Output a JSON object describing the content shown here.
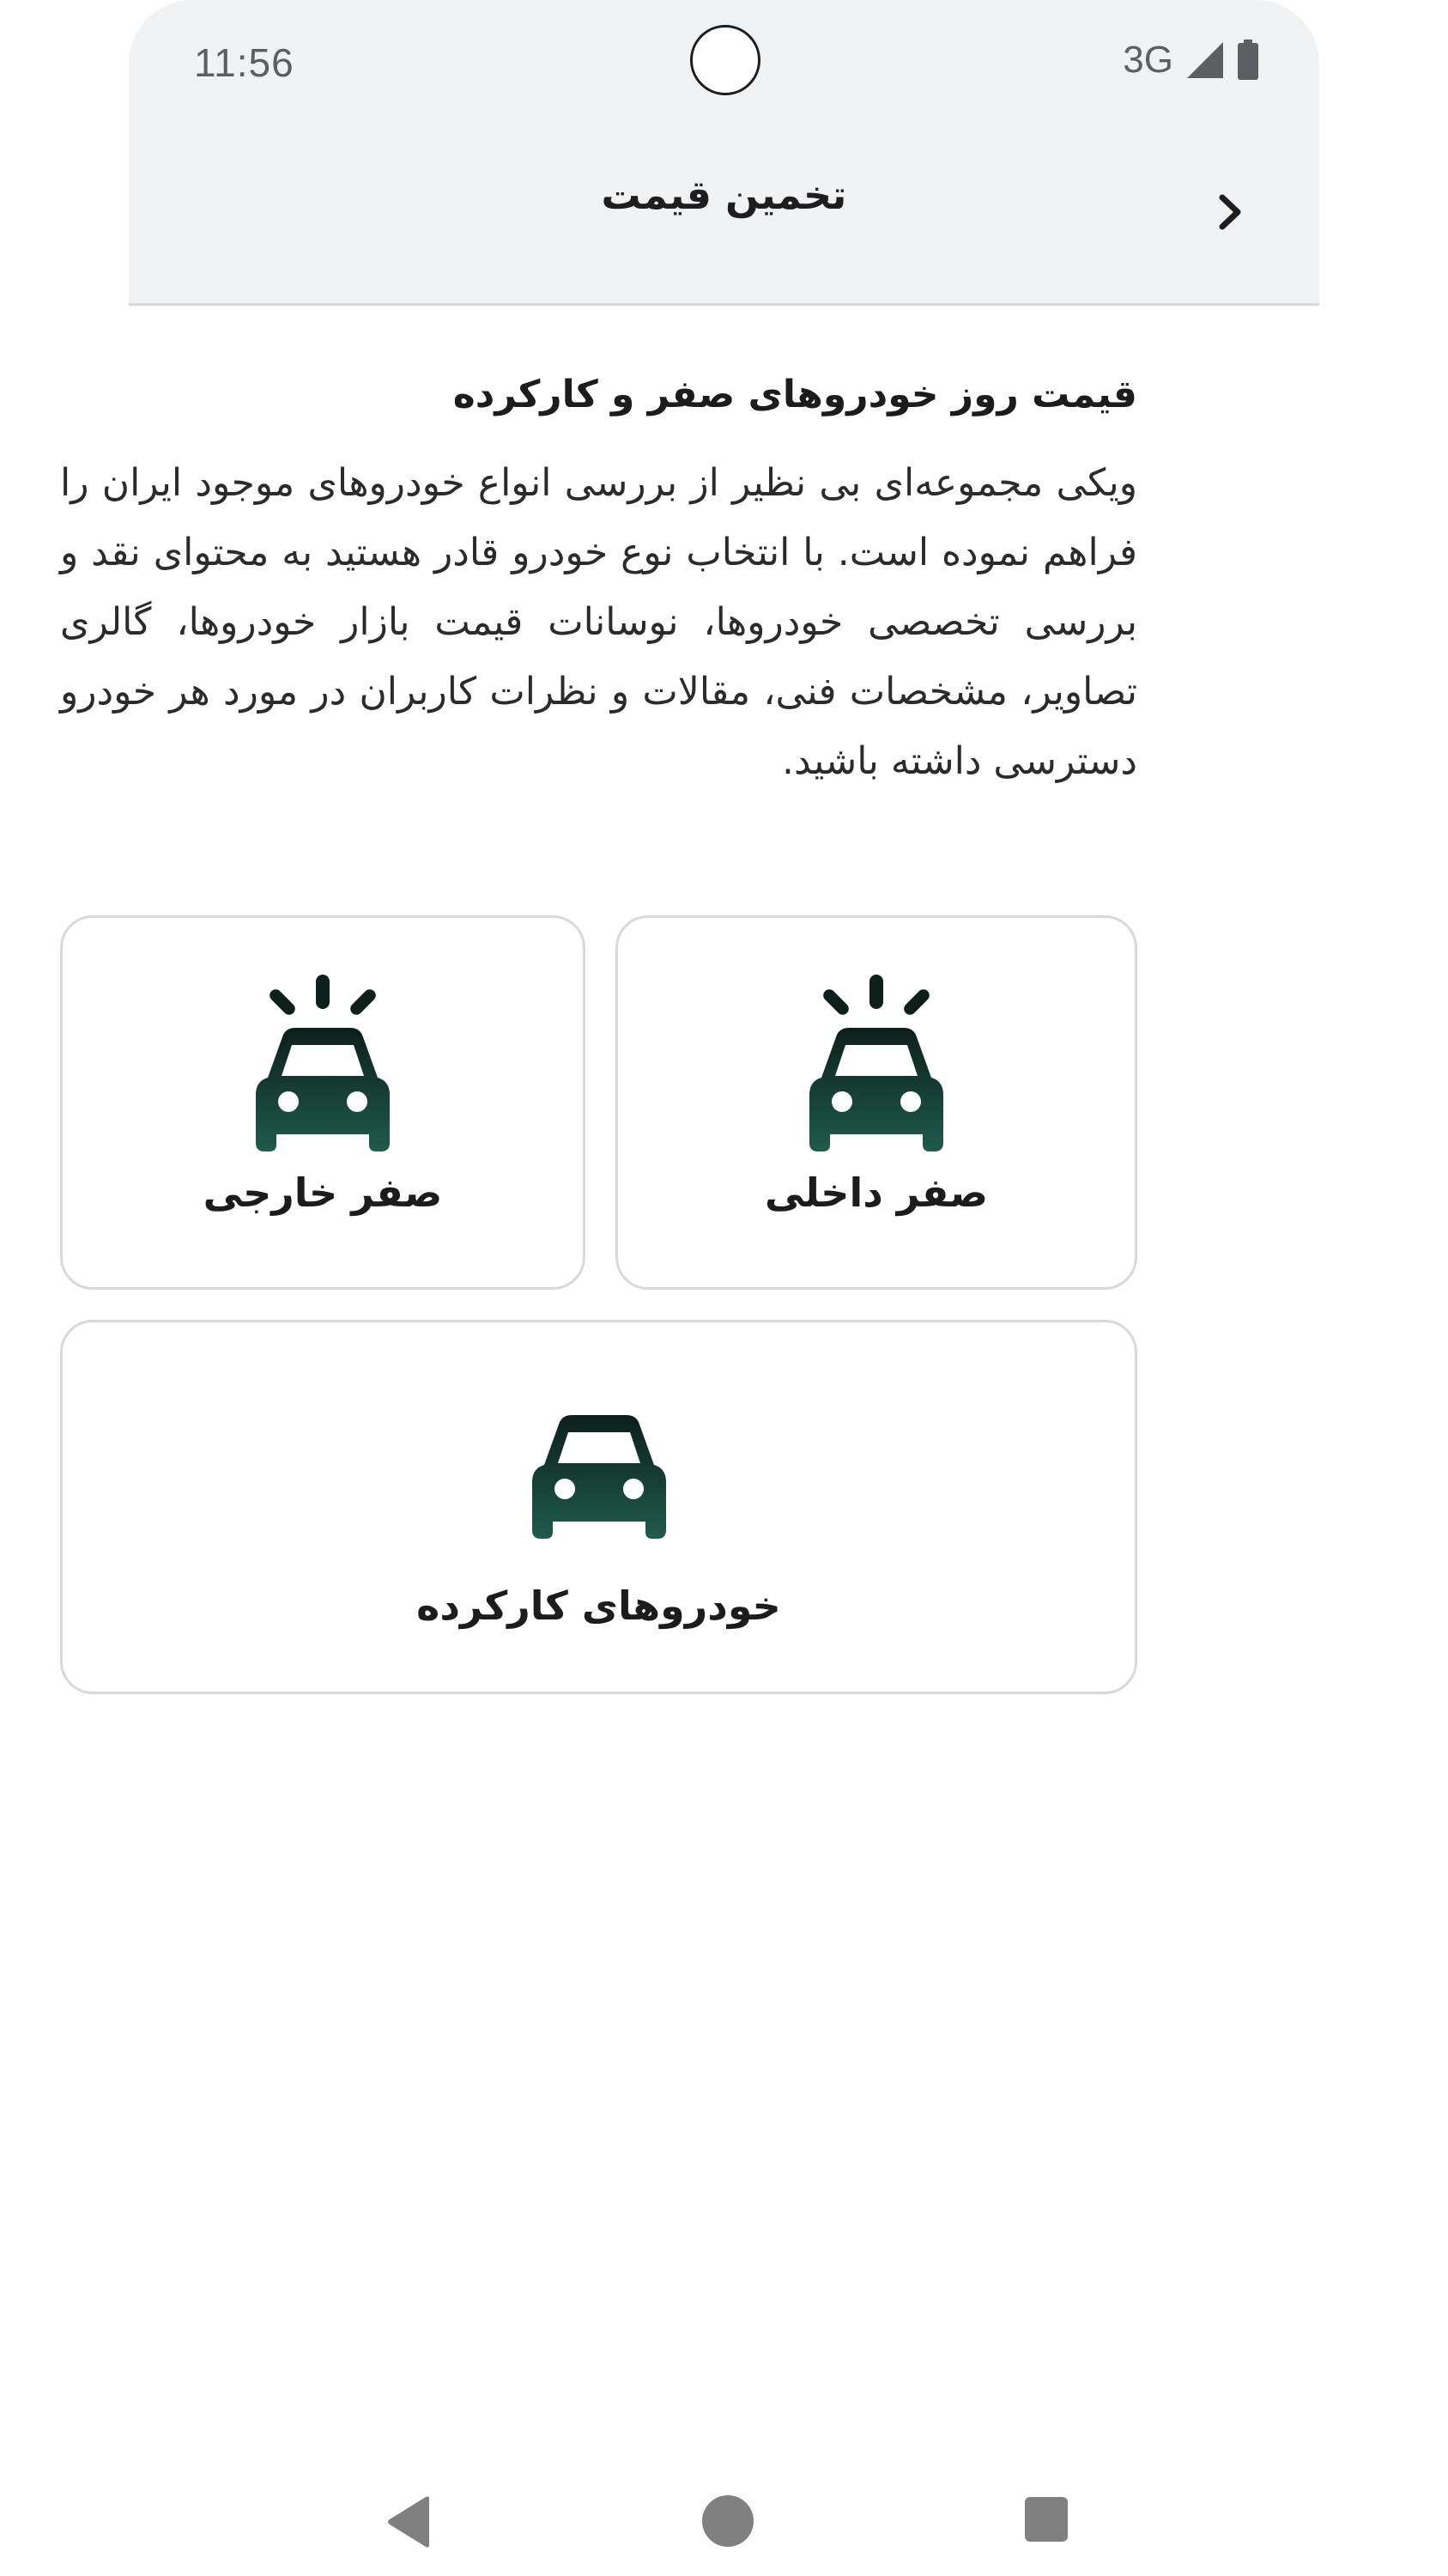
{
  "status_bar": {
    "time": "11:56",
    "network": "3G",
    "icons": [
      "signal-icon",
      "battery-icon"
    ]
  },
  "header": {
    "title": "تخمین قیمت",
    "back_icon": "chevron-right-icon"
  },
  "main": {
    "section_title": "قیمت روز خودروهای صفر و کارکرده",
    "intro": "ویکی مجموعه‌ای بی نظیر از بررسی انواع خودروهای موجود ایران را فراهم نموده است. با انتخاب نوع خودرو قادر هستید به محتوای نقد و بررسی تخصصی خودروها، نوسانات قیمت بازار خودروها، گالری تصاویر، مشخصات فنی، مقالات و نظرات کاربران در مورد هر خودرو دسترسی داشته باشید.",
    "cards": {
      "domestic_new": {
        "label": "صفر داخلی",
        "icon": "new-car-icon"
      },
      "foreign_new": {
        "label": "صفر خارجی",
        "icon": "new-car-icon"
      },
      "used_cars": {
        "label": "خودروهای کارکرده",
        "icon": "car-icon"
      }
    }
  },
  "colors": {
    "accent_dark": "#0d2a24",
    "accent_green": "#1f5b4c",
    "header_bg": "#f1f2f4"
  },
  "nav_bar": {
    "icons": [
      "back-triangle-icon",
      "home-circle-icon",
      "recents-square-icon"
    ]
  }
}
